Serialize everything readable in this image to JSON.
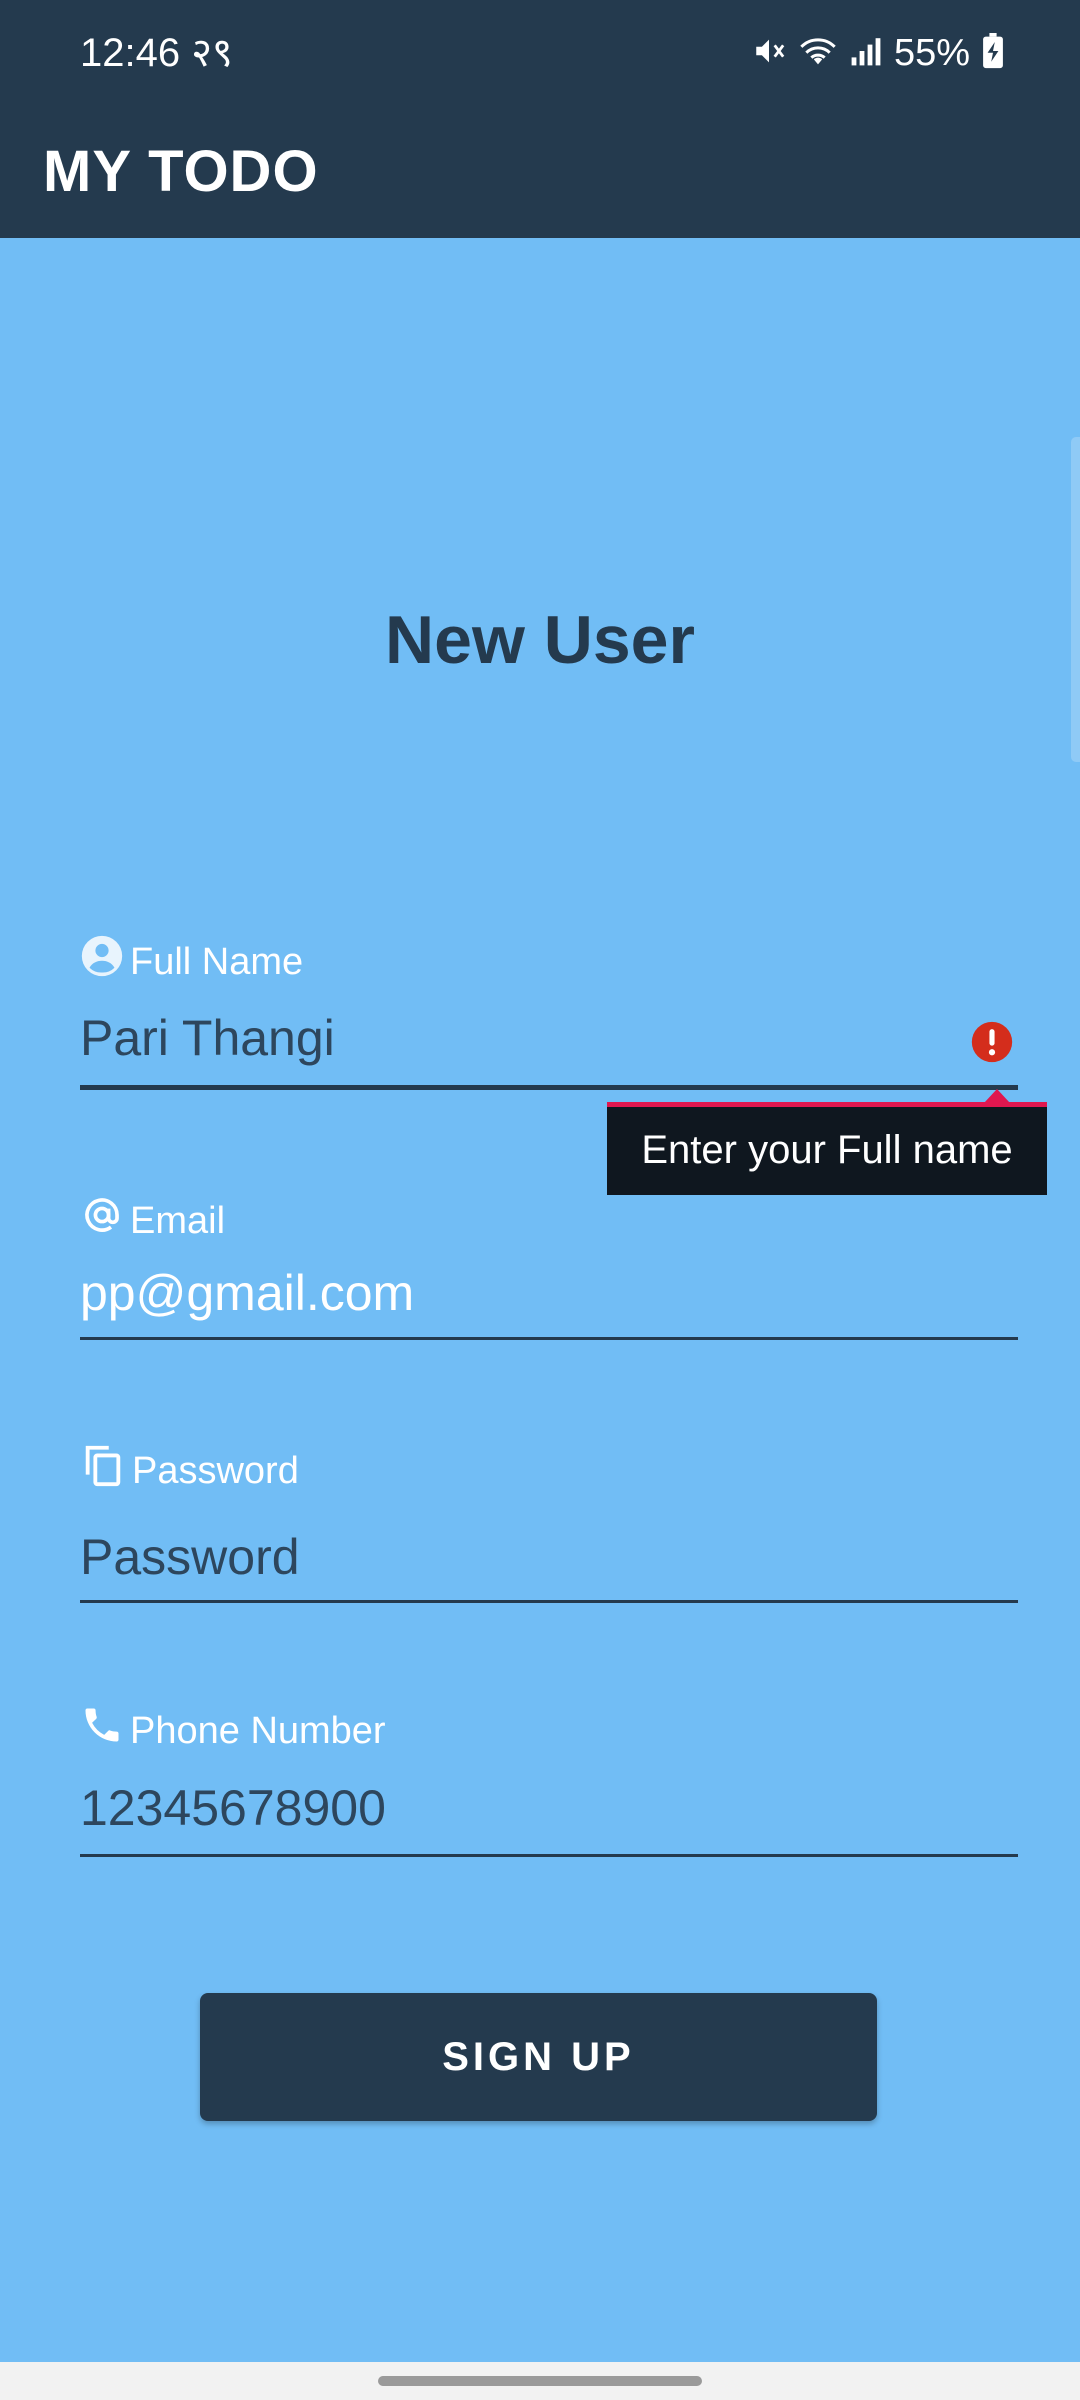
{
  "status_bar": {
    "time": "12:46",
    "time_suffix": "२९",
    "battery": "55%",
    "icons": [
      "mute-icon",
      "wifi-icon",
      "signal-icon",
      "battery-charging-icon"
    ]
  },
  "app_bar": {
    "title": "MY TODO"
  },
  "form": {
    "heading": "New User",
    "full_name": {
      "label": "Full Name",
      "value": "Pari Thangi",
      "icon": "account-circle-icon"
    },
    "email": {
      "label": "Email",
      "value": "pp@gmail.com",
      "icon": "at-sign-icon"
    },
    "password": {
      "label": "Password",
      "placeholder": "Password",
      "icon": "copy-icon"
    },
    "phone": {
      "label": "Phone Number",
      "value": "12345678900",
      "icon": "phone-icon"
    },
    "error_tooltip": "Enter your Full name",
    "signup_label": "SIGN UP"
  },
  "colors": {
    "background": "#71bdf5",
    "primary_dark": "#243a4e",
    "error": "#e0174f",
    "error_icon": "#d42d1c"
  }
}
